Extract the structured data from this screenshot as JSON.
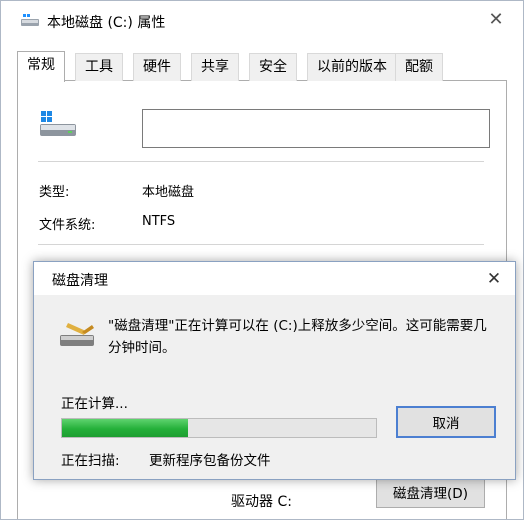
{
  "window": {
    "title": "本地磁盘 (C:) 属性",
    "close_glyph": "✕"
  },
  "tabs": [
    {
      "label": "常规",
      "active": true
    },
    {
      "label": "工具"
    },
    {
      "label": "硬件"
    },
    {
      "label": "共享"
    },
    {
      "label": "安全"
    },
    {
      "label": "以前的版本"
    },
    {
      "label": "配额"
    }
  ],
  "general": {
    "name_value": "",
    "type_label": "类型:",
    "type_value": "本地磁盘",
    "fs_label": "文件系统:",
    "fs_value": "NTFS",
    "drive_label": "驱动器 C:",
    "cleanup_button": "磁盘清理(D)"
  },
  "dialog": {
    "title": "磁盘清理",
    "close_glyph": "✕",
    "message": "\"磁盘清理\"正在计算可以在 (C:)上释放多少空间。这可能需要几分钟时间。",
    "status": "正在计算...",
    "progress": 0.4,
    "cancel_label": "取消",
    "scan_label": "正在扫描:",
    "scan_value": "更新程序包备份文件"
  },
  "colors": {
    "progress_green": "#25b03a",
    "accent_blue": "#4c7fd1"
  },
  "icons": {
    "title": "drive-icon",
    "drive": "windows-drive-icon",
    "dialog": "disk-cleanup-icon"
  }
}
